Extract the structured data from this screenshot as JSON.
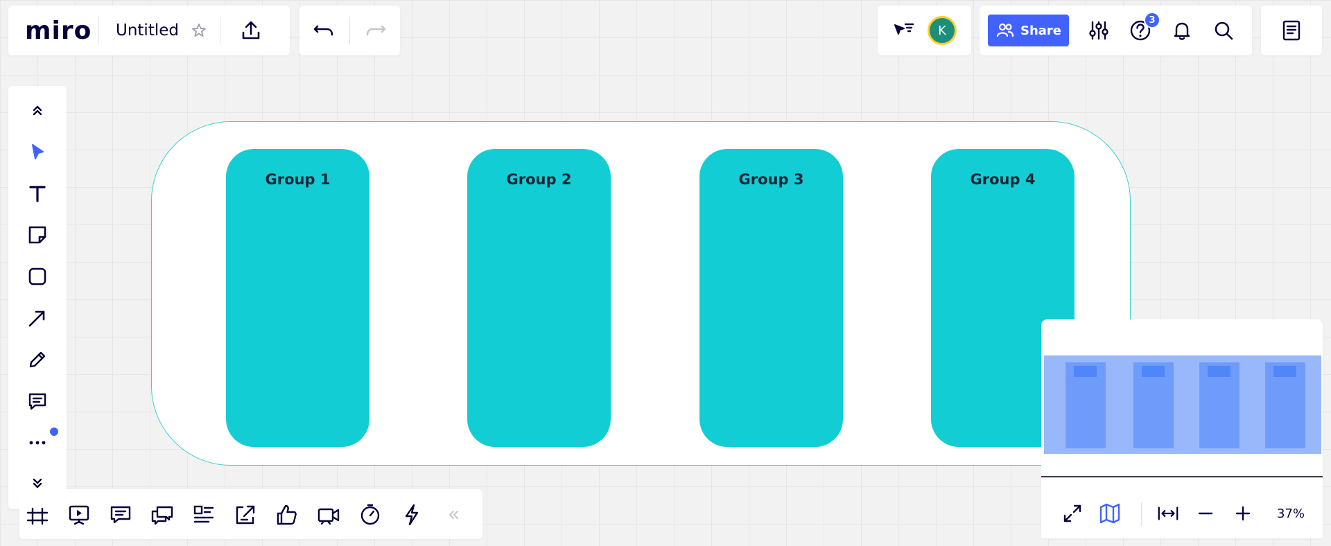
{
  "header": {
    "logo": "miro",
    "board_title": "Untitled",
    "share_label": "Share",
    "help_badge": "3",
    "avatar_initial": "K"
  },
  "frame": {
    "groups": [
      {
        "label": "Group 1"
      },
      {
        "label": "Group 2"
      },
      {
        "label": "Group 3"
      },
      {
        "label": "Group 4"
      }
    ]
  },
  "minimap": {
    "zoom_label": "37%"
  },
  "colors": {
    "accent": "#4262ff",
    "group_fill": "#13cdd4",
    "frame_border": "#3fcfcf",
    "avatar": "#1b8f7b",
    "avatar_ring": "#ffd02f"
  },
  "toolbar": {
    "tools": [
      "collapse-up-icon",
      "select-icon",
      "text-icon",
      "sticky-note-icon",
      "shape-icon",
      "arrow-icon",
      "pen-icon",
      "comment-icon",
      "more-icon",
      "collapse-down-icon"
    ]
  },
  "bottombar": {
    "tools": [
      "frames-icon",
      "presentation-icon",
      "comments-icon",
      "chat-icon",
      "cards-icon",
      "share-out-icon",
      "voting-icon",
      "video-icon",
      "timer-icon",
      "lightning-icon",
      "collapse-left-icon"
    ]
  }
}
